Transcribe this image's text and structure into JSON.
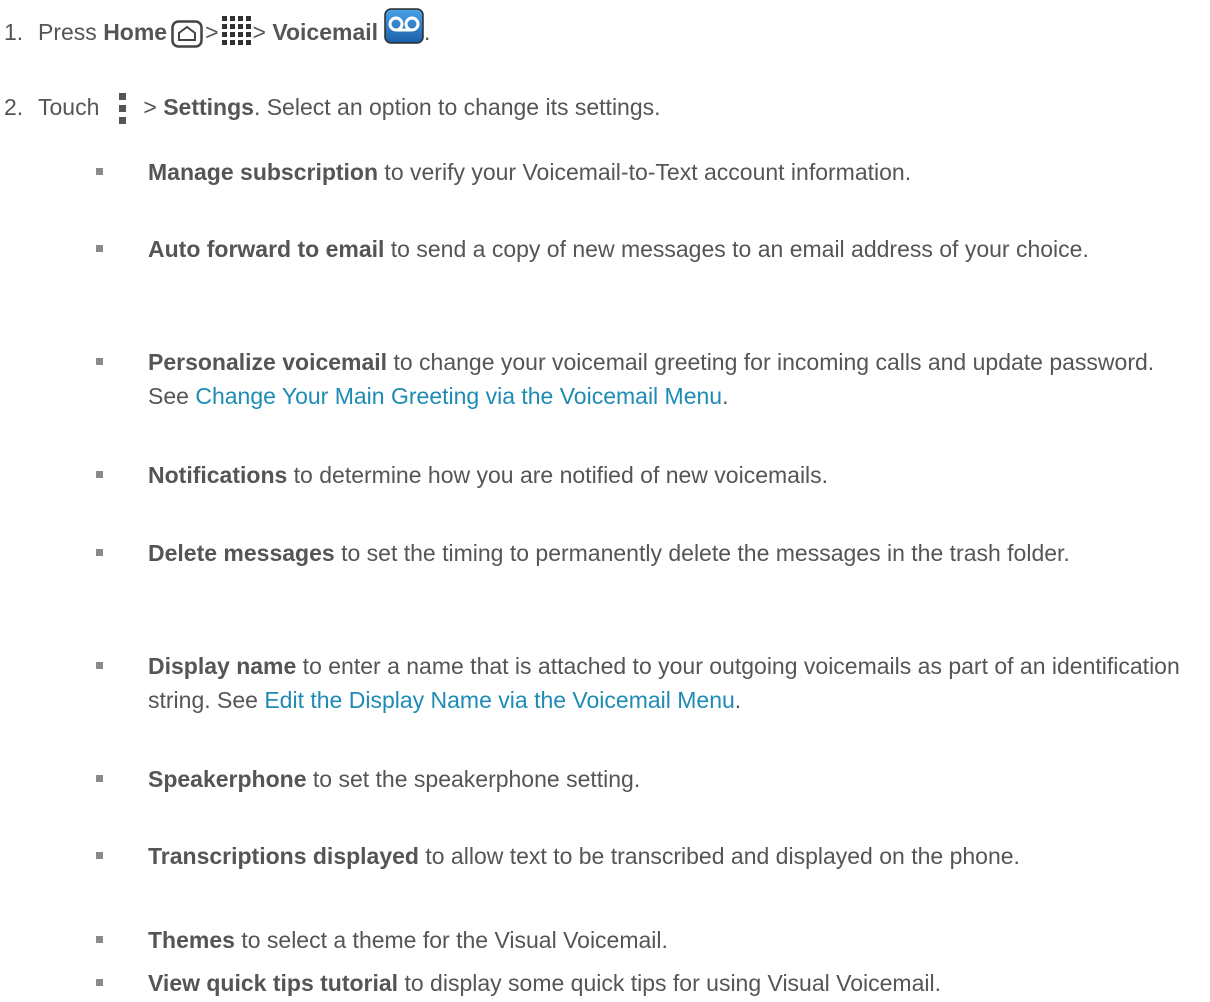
{
  "steps": {
    "step1": {
      "number": "1.",
      "press": "Press",
      "home_label": "Home",
      "sep1": ">",
      "sep2": ">",
      "voicemail_label": "Voicemail",
      "period": "."
    },
    "step2": {
      "number": "2.",
      "touch": "Touch",
      "sep": ">",
      "settings_label": "Settings",
      "rest": ". Select an option to change its settings."
    }
  },
  "options": [
    {
      "term": "Manage subscription",
      "desc": " to verify your Voicemail-to-Text account information."
    },
    {
      "term": "Auto forward to email",
      "desc": " to send a copy of new messages to an email address of your choice."
    },
    {
      "term": "Personalize voicemail",
      "desc": " to change your voicemail greeting for incoming calls and update password. See ",
      "link": "Change Your Main Greeting via the Voicemail Menu",
      "after": "."
    },
    {
      "term": "Notifications",
      "desc": " to determine how you are notified of new voicemails."
    },
    {
      "term": "Delete messages",
      "desc": " to set the timing to permanently delete the messages in the trash folder."
    },
    {
      "term": "Display name",
      "desc": " to enter a name that is attached to your outgoing voicemails as part of an identification string. See ",
      "link": "Edit the Display Name via the Voicemail Menu",
      "after": "."
    },
    {
      "term": "Speakerphone",
      "desc": " to set the speakerphone setting."
    },
    {
      "term": "Transcriptions displayed",
      "desc": " to allow text to be transcribed and displayed on the phone."
    },
    {
      "term": "Themes",
      "desc": " to select a theme for the Visual Voicemail."
    },
    {
      "term": "View quick tips tutorial",
      "desc": " to display some quick tips for using Visual Voicemail."
    }
  ],
  "icons": {
    "home": "home-key-icon",
    "apps": "apps-grid-icon",
    "voicemail": "voicemail-app-icon",
    "menu": "menu-dots-icon"
  },
  "colors": {
    "text": "#555555",
    "link": "#1e8bb5",
    "bullet": "#8a8a8a"
  }
}
